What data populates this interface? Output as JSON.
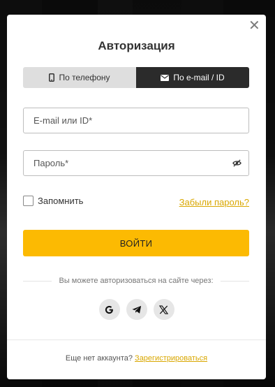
{
  "modal": {
    "close_icon": "close-icon",
    "title": "Авторизация",
    "tabs": [
      {
        "label": "По телефону",
        "icon": "phone-icon",
        "active": false
      },
      {
        "label": "По e-mail / ID",
        "icon": "envelope-icon",
        "active": true
      }
    ],
    "email_field": {
      "placeholder": "E-mail или ID*",
      "value": ""
    },
    "password_field": {
      "placeholder": "Пароль*",
      "value": "",
      "icon": "eye-icon"
    },
    "remember_label": "Запомнить",
    "remember_checked": false,
    "forgot_link": "Забыли пароль?",
    "login_button": "ВОЙТИ",
    "social_prompt": "Вы можете авторизоваться на сайте через:",
    "socials": [
      "google-icon",
      "telegram-icon",
      "x-icon"
    ],
    "footer": {
      "text": "Еще нет аккаунта?",
      "register_link": "Зарегистрироваться"
    }
  },
  "colors": {
    "accent": "#fcba02",
    "link": "#d9a700",
    "active_tab": "#2b2b2b",
    "inactive_tab": "#dedede"
  }
}
